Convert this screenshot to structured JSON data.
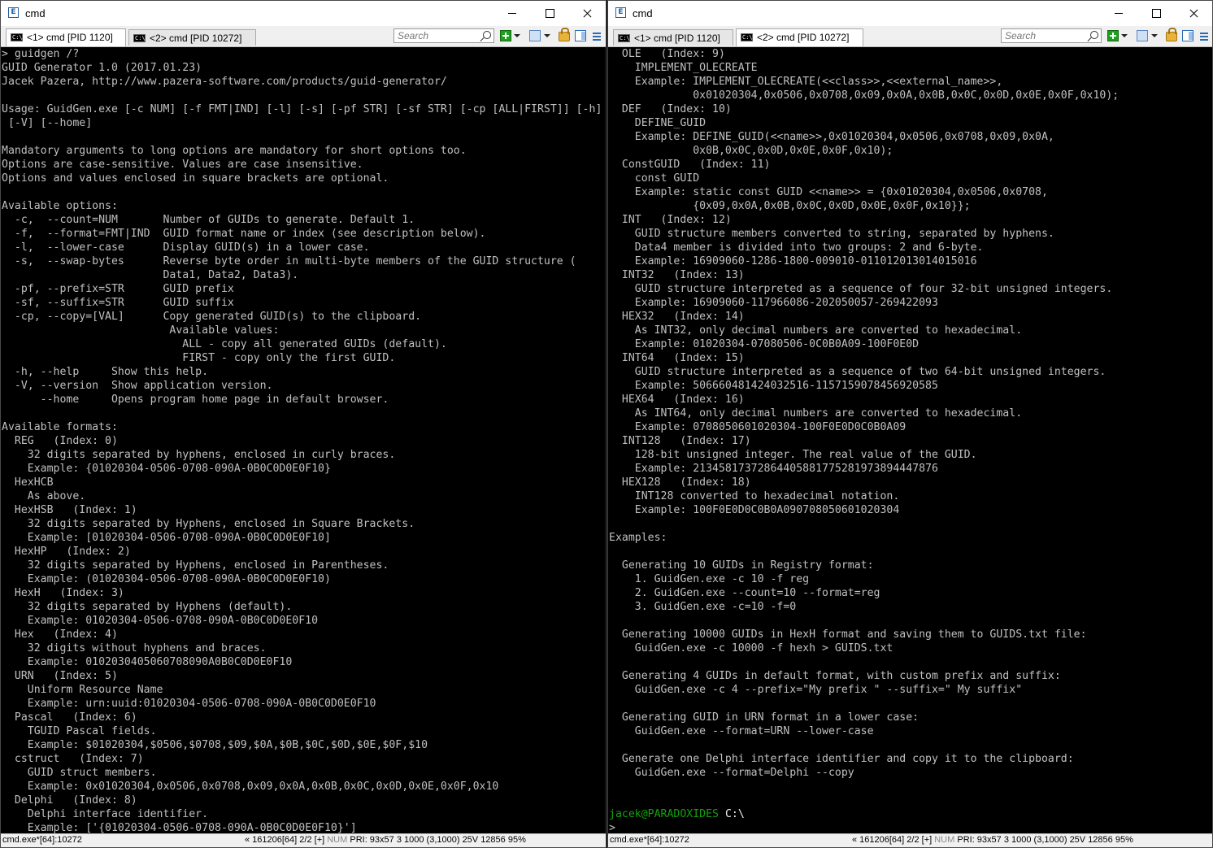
{
  "left": {
    "title": "cmd",
    "tabs": [
      "<1> cmd [PID 1120]",
      "<2> cmd [PID 10272]"
    ],
    "search_placeholder": "Search",
    "status": {
      "process": "cmd.exe*[64]:10272",
      "info": "« 161206[64]   2/2   [+]",
      "num": "NUM",
      "rest": "PRI:   93x57   3   1000   (3,1000) 25V   12856  95%"
    },
    "lines": [
      "> guidgen /?",
      "GUID Generator 1.0 (2017.01.23)",
      "Jacek Pazera, http://www.pazera-software.com/products/guid-generator/",
      "",
      "Usage: GuidGen.exe [-c NUM] [-f FMT|IND] [-l] [-s] [-pf STR] [-sf STR] [-cp [ALL|FIRST]] [-h]",
      " [-V] [--home]",
      "",
      "Mandatory arguments to long options are mandatory for short options too.",
      "Options are case-sensitive. Values are case insensitive.",
      "Options and values enclosed in square brackets are optional.",
      "",
      "Available options:",
      "  -c,  --count=NUM       Number of GUIDs to generate. Default 1.",
      "  -f,  --format=FMT|IND  GUID format name or index (see description below).",
      "  -l,  --lower-case      Display GUID(s) in a lower case.",
      "  -s,  --swap-bytes      Reverse byte order in multi-byte members of the GUID structure (",
      "                         Data1, Data2, Data3).",
      "  -pf, --prefix=STR      GUID prefix",
      "  -sf, --suffix=STR      GUID suffix",
      "  -cp, --copy=[VAL]      Copy generated GUID(s) to the clipboard.",
      "                          Available values:",
      "                            ALL - copy all generated GUIDs (default).",
      "                            FIRST - copy only the first GUID.",
      "  -h, --help     Show this help.",
      "  -V, --version  Show application version.",
      "      --home     Opens program home page in default browser.",
      "",
      "Available formats:",
      "  REG   (Index: 0)",
      "    32 digits separated by hyphens, enclosed in curly braces.",
      "    Example: {01020304-0506-0708-090A-0B0C0D0E0F10}",
      "  HexHCB",
      "    As above.",
      "  HexHSB   (Index: 1)",
      "    32 digits separated by Hyphens, enclosed in Square Brackets.",
      "    Example: [01020304-0506-0708-090A-0B0C0D0E0F10]",
      "  HexHP   (Index: 2)",
      "    32 digits separated by Hyphens, enclosed in Parentheses.",
      "    Example: (01020304-0506-0708-090A-0B0C0D0E0F10)",
      "  HexH   (Index: 3)",
      "    32 digits separated by Hyphens (default).",
      "    Example: 01020304-0506-0708-090A-0B0C0D0E0F10",
      "  Hex   (Index: 4)",
      "    32 digits without hyphens and braces.",
      "    Example: 0102030405060708090A0B0C0D0E0F10",
      "  URN   (Index: 5)",
      "    Uniform Resource Name",
      "    Example: urn:uuid:01020304-0506-0708-090A-0B0C0D0E0F10",
      "  Pascal   (Index: 6)",
      "    TGUID Pascal fields.",
      "    Example: $01020304,$0506,$0708,$09,$0A,$0B,$0C,$0D,$0E,$0F,$10",
      "  cstruct   (Index: 7)",
      "    GUID struct members.",
      "    Example: 0x01020304,0x0506,0x0708,0x09,0x0A,0x0B,0x0C,0x0D,0x0E,0x0F,0x10",
      "  Delphi   (Index: 8)",
      "    Delphi interface identifier.",
      "    Example: ['{01020304-0506-0708-090A-0B0C0D0E0F10}']"
    ]
  },
  "right": {
    "title": "cmd",
    "tabs": [
      "<1> cmd [PID 1120]",
      "<2> cmd [PID 10272]"
    ],
    "search_placeholder": "Search",
    "status": {
      "process": "cmd.exe*[64]:10272",
      "info": "« 161206[64]   2/2   [+]",
      "num": "NUM",
      "rest": "PRI:   93x57   3   1000   (3,1000) 25V   12856  95%"
    },
    "lines": [
      "  OLE   (Index: 9)",
      "    IMPLEMENT_OLECREATE",
      "    Example: IMPLEMENT_OLECREATE(<<class>>,<<external_name>>,",
      "             0x01020304,0x0506,0x0708,0x09,0x0A,0x0B,0x0C,0x0D,0x0E,0x0F,0x10);",
      "  DEF   (Index: 10)",
      "    DEFINE_GUID",
      "    Example: DEFINE_GUID(<<name>>,0x01020304,0x0506,0x0708,0x09,0x0A,",
      "             0x0B,0x0C,0x0D,0x0E,0x0F,0x10);",
      "  ConstGUID   (Index: 11)",
      "    const GUID",
      "    Example: static const GUID <<name>> = {0x01020304,0x0506,0x0708,",
      "             {0x09,0x0A,0x0B,0x0C,0x0D,0x0E,0x0F,0x10}};",
      "  INT   (Index: 12)",
      "    GUID structure members converted to string, separated by hyphens.",
      "    Data4 member is divided into two groups: 2 and 6-byte.",
      "    Example: 16909060-1286-1800-009010-011012013014015016",
      "  INT32   (Index: 13)",
      "    GUID structure interpreted as a sequence of four 32-bit unsigned integers.",
      "    Example: 16909060-117966086-202050057-269422093",
      "  HEX32   (Index: 14)",
      "    As INT32, only decimal numbers are converted to hexadecimal.",
      "    Example: 01020304-07080506-0C0B0A09-100F0E0D",
      "  INT64   (Index: 15)",
      "    GUID structure interpreted as a sequence of two 64-bit unsigned integers.",
      "    Example: 506660481424032516-1157159078456920585",
      "  HEX64   (Index: 16)",
      "    As INT64, only decimal numbers are converted to hexadecimal.",
      "    Example: 0708050601020304-100F0E0D0C0B0A09",
      "  INT128   (Index: 17)",
      "    128-bit unsigned integer. The real value of the GUID.",
      "    Example: 21345817372864405881775281973894447876",
      "  HEX128   (Index: 18)",
      "    INT128 converted to hexadecimal notation.",
      "    Example: 100F0E0D0C0B0A090708050601020304",
      "",
      "Examples:",
      "",
      "  Generating 10 GUIDs in Registry format:",
      "    1. GuidGen.exe -c 10 -f reg",
      "    2. GuidGen.exe --count=10 --format=reg",
      "    3. GuidGen.exe -c=10 -f=0",
      "",
      "  Generating 10000 GUIDs in HexH format and saving them to GUIDS.txt file:",
      "    GuidGen.exe -c 10000 -f hexh > GUIDS.txt",
      "",
      "  Generating 4 GUIDs in default format, with custom prefix and suffix:",
      "    GuidGen.exe -c 4 --prefix=\"My prefix \" --suffix=\" My suffix\"",
      "",
      "  Generating GUID in URN format in a lower case:",
      "    GuidGen.exe --format=URN --lower-case",
      "",
      "  Generate one Delphi interface identifier and copy it to the clipboard:",
      "    GuidGen.exe --format=Delphi --copy",
      "",
      ""
    ],
    "prompt_user": "jacek@PARADOXIDES",
    "prompt_path": "C:\\",
    "prompt_char": ">"
  }
}
